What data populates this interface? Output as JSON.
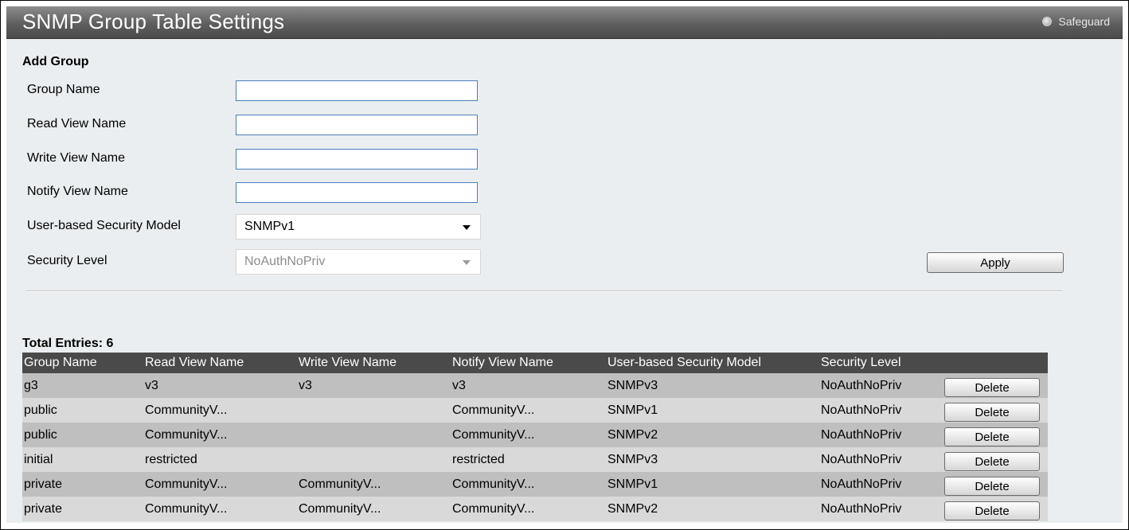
{
  "header": {
    "title": "SNMP Group Table Settings",
    "safeguard_label": "Safeguard"
  },
  "add_group": {
    "section_title": "Add Group",
    "fields": {
      "group_name": {
        "label": "Group Name",
        "value": ""
      },
      "read_view_name": {
        "label": "Read View Name",
        "value": ""
      },
      "write_view_name": {
        "label": "Write View Name",
        "value": ""
      },
      "notify_view_name": {
        "label": "Notify View Name",
        "value": ""
      },
      "security_model": {
        "label": "User-based Security Model",
        "value": "SNMPv1"
      },
      "security_level": {
        "label": "Security Level",
        "value": "NoAuthNoPriv",
        "disabled": true
      }
    },
    "apply_label": "Apply"
  },
  "table": {
    "total_entries_label": "Total Entries: 6",
    "columns": [
      "Group Name",
      "Read View Name",
      "Write View Name",
      "Notify View Name",
      "User-based Security Model",
      "Security Level"
    ],
    "delete_label": "Delete",
    "rows": [
      {
        "group": "g3",
        "read": "v3",
        "write": "v3",
        "notify": "v3",
        "model": "SNMPv3",
        "level": "NoAuthNoPriv"
      },
      {
        "group": "public",
        "read": "CommunityV...",
        "write": "",
        "notify": "CommunityV...",
        "model": "SNMPv1",
        "level": "NoAuthNoPriv"
      },
      {
        "group": "public",
        "read": "CommunityV...",
        "write": "",
        "notify": "CommunityV...",
        "model": "SNMPv2",
        "level": "NoAuthNoPriv"
      },
      {
        "group": "initial",
        "read": "restricted",
        "write": "",
        "notify": "restricted",
        "model": "SNMPv3",
        "level": "NoAuthNoPriv"
      },
      {
        "group": "private",
        "read": "CommunityV...",
        "write": "CommunityV...",
        "notify": "CommunityV...",
        "model": "SNMPv1",
        "level": "NoAuthNoPriv"
      },
      {
        "group": "private",
        "read": "CommunityV...",
        "write": "CommunityV...",
        "notify": "CommunityV...",
        "model": "SNMPv2",
        "level": "NoAuthNoPriv"
      }
    ]
  }
}
